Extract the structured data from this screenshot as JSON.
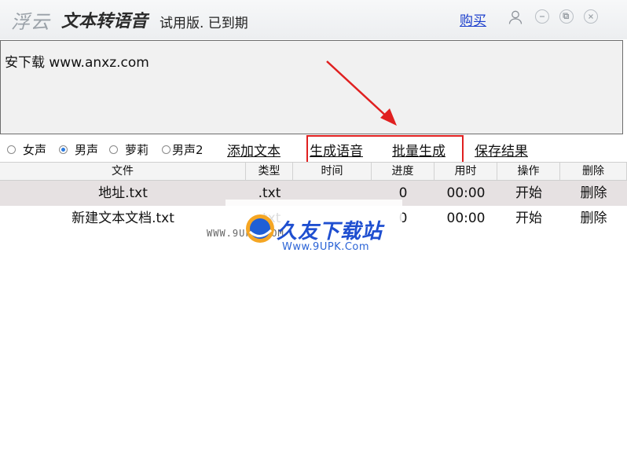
{
  "title_bar": {
    "brand": "浮云",
    "app_name": "文本转语音",
    "trial_status": "试用版. 已到期",
    "buy_link": "购买",
    "icons": [
      "user-icon",
      "minimize-icon",
      "maximize-icon",
      "close-icon"
    ]
  },
  "editor": {
    "value": "安下载  www.anxz.com"
  },
  "voices": {
    "options": [
      "女声",
      "男声",
      "萝莉",
      "男声2"
    ],
    "selected": "男声"
  },
  "actions": {
    "add_text": "添加文本",
    "generate_voice": "生成语音",
    "batch_generate": "批量生成",
    "save_result": "保存结果"
  },
  "table": {
    "columns": [
      "文件",
      "类型",
      "时间",
      "进度",
      "用时",
      "操作",
      "删除"
    ],
    "rows": [
      {
        "file": "地址.txt",
        "type": ".txt",
        "time": "",
        "progress": "0",
        "elapsed": "00:00",
        "action": "开始",
        "delete": "删除"
      },
      {
        "file": "新建文本文档.txt",
        "type": ".txt",
        "time": "",
        "progress": "0",
        "elapsed": "00:00",
        "action": "开始",
        "delete": "删除"
      }
    ]
  },
  "watermark": {
    "left_text": "WWW.9UPK.COM",
    "name": "久友下载站",
    "url": "Www.9UPK.Com"
  },
  "colors": {
    "link": "#1a3dcc",
    "annotation_red": "#e02020",
    "radio_selected": "#2a7be0",
    "selected_row": "#e6e1e2"
  }
}
